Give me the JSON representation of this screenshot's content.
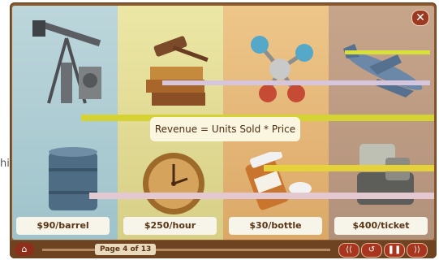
{
  "side_text": "hir",
  "formula": "Revenue = Units Sold * Price",
  "labels": {
    "oil": "$90/barrel",
    "clock": "$250/hour",
    "bottle": "$30/bottle",
    "ticket": "$400/ticket"
  },
  "footer": {
    "page": "Page 4 of 13"
  },
  "icons": {
    "close": "close-icon",
    "home": "home-icon",
    "rewind": "rewind-icon",
    "replay": "replay-icon",
    "pause": "pause-icon",
    "forward": "forward-icon"
  }
}
